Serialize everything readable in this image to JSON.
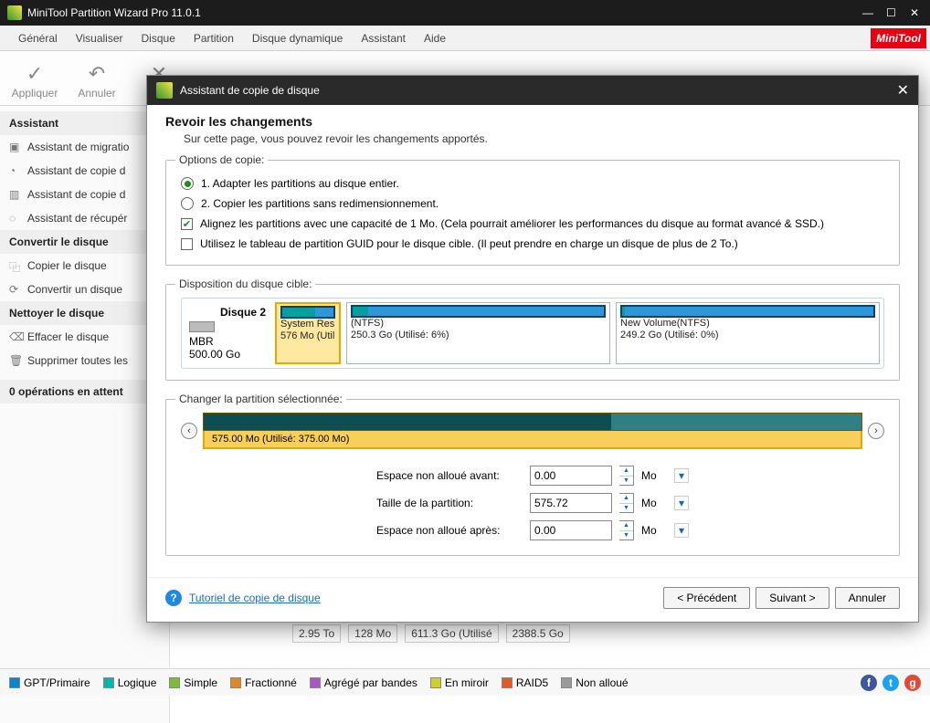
{
  "window": {
    "title": "MiniTool Partition Wizard Pro 11.0.1",
    "brand1": "Mini",
    "brand2": "Tool"
  },
  "menu": {
    "general": "Général",
    "visualiser": "Visualiser",
    "disque": "Disque",
    "partition": "Partition",
    "dyn": "Disque dynamique",
    "assistant": "Assistant",
    "aide": "Aide"
  },
  "toolbar": {
    "apply": "Appliquer",
    "undo": "Annuler",
    "cancel": "Annu"
  },
  "sidebar": {
    "cat_assistant": "Assistant",
    "items_assistant": [
      "Assistant de migratio",
      "Assistant de copie d",
      "Assistant de copie d",
      "Assistant de récupér"
    ],
    "cat_convert": "Convertir le disque",
    "items_convert": [
      "Copier le disque",
      "Convertir un disque"
    ],
    "cat_clean": "Nettoyer le disque",
    "items_clean": [
      "Effacer le disque",
      "Supprimer toutes les"
    ],
    "pending": "0 opérations en attent"
  },
  "modal": {
    "title": "Assistant de copie de disque",
    "head": "Revoir les changements",
    "sub": "Sur cette page, vous pouvez revoir les changements apportés.",
    "opt_legend": "Options de copie:",
    "opt1": "1. Adapter les partitions au disque entier.",
    "opt2": "2. Copier les partitions sans redimensionnement.",
    "align": "Alignez les partitions avec une capacité de 1 Mo. (Cela pourrait améliorer les performances du disque au format avancé & SSD.)",
    "guid": "Utilisez le tableau de partition GUID pour le disque cible. (Il peut prendre en charge un disque de plus de 2 To.)",
    "layout_legend": "Disposition du disque cible:",
    "disk": {
      "name": "Disque 2",
      "type": "MBR",
      "size": "500.00 Go"
    },
    "p1": {
      "name": "System Res",
      "line2": "576 Mo (Util"
    },
    "p2": {
      "name": "(NTFS)",
      "line2": "250.3 Go (Utilisé: 6%)"
    },
    "p3": {
      "name": "New Volume(NTFS)",
      "line2": "249.2 Go (Utilisé: 0%)"
    },
    "change_legend": "Changer la partition sélectionnée:",
    "tracklabel": "575.00 Mo (Utilisé: 375.00 Mo)",
    "lbl_before": "Espace non alloué avant:",
    "lbl_size": "Taille de la partition:",
    "lbl_after": "Espace non alloué après:",
    "val_before": "0.00",
    "val_size": "575.72",
    "val_after": "0.00",
    "unit": "Mo",
    "help": "Tutoriel de copie de disque",
    "prev": "< Précédent",
    "next": "Suivant >",
    "cancel": "Annuler"
  },
  "bg": {
    "c1": "2.95 To",
    "c2": "128 Mo",
    "c3": "611.3 Go (Utilisé",
    "c4": "2388.5 Go"
  },
  "legend": {
    "gpt": "GPT/Primaire",
    "logique": "Logique",
    "simple": "Simple",
    "frac": "Fractionné",
    "bande": "Agrégé par bandes",
    "miroir": "En miroir",
    "raid": "RAID5",
    "nonall": "Non alloué"
  }
}
